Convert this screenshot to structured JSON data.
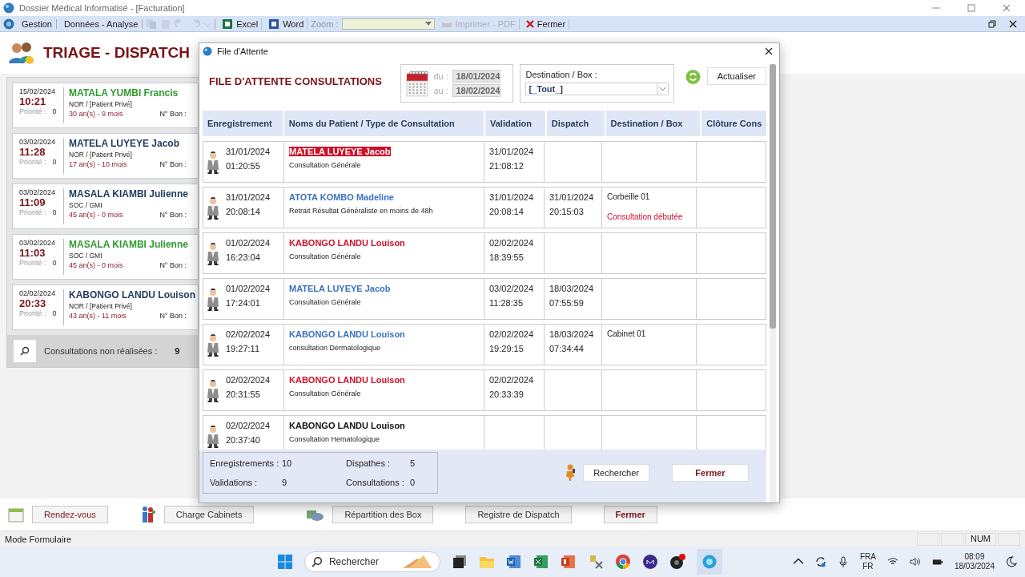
{
  "window": {
    "title": "Dossier Médical Informatisé - [Facturation]"
  },
  "toolbar": {
    "menus": [
      "Gestion",
      "Données - Analyse"
    ],
    "buttons": [
      {
        "label": "Excel",
        "kind": "excel"
      },
      {
        "label": "Word",
        "kind": "word"
      }
    ],
    "zoom_label": "Zoom :",
    "print": {
      "label": "Imprimer - PDF",
      "disabled": true
    },
    "close": "Fermer"
  },
  "page": {
    "title": "TRIAGE - DISPATCH"
  },
  "queue": [
    {
      "date": "15/02/2024",
      "time": "10:21",
      "priority_label": "Priorité :",
      "priority": "0",
      "name": "MATALA YUMBI Francis",
      "color": "#2e9b2e",
      "category": "NOR / [Patient Privé]",
      "age": "30 an(s) - 9 mois",
      "bon_label": "N° Bon :"
    },
    {
      "date": "03/02/2024",
      "time": "11:28",
      "priority_label": "Priorité :",
      "priority": "0",
      "name": "MATELA LUYEYE Jacob",
      "color": "#1f3a5c",
      "category": "NOR / [Patient Privé]",
      "age": "17 an(s) - 10 mois",
      "bon_label": "N° Bon :"
    },
    {
      "date": "03/02/2024",
      "time": "11:09",
      "priority_label": "Priorité :",
      "priority": "0",
      "name": "MASALA KIAMBI Julienne",
      "color": "#1f3a5c",
      "category": "SOC / GMI",
      "age": "45 an(s) - 0 mois",
      "bon_label": "N° Bon :"
    },
    {
      "date": "03/02/2024",
      "time": "11:03",
      "priority_label": "Priorité :",
      "priority": "0",
      "name": "MASALA KIAMBI Julienne",
      "color": "#2e9b2e",
      "category": "SOC / GMI",
      "age": "45 an(s) - 0 mois",
      "bon_label": "N° Bon :"
    },
    {
      "date": "02/02/2024",
      "time": "20:33",
      "priority_label": "Priorité :",
      "priority": "0",
      "name": "KABONGO LANDU Louison",
      "color": "#1f3a5c",
      "category": "NOR / [Patient Privé]",
      "age": "43 an(s) - 11 mois",
      "bon_label": "N° Bon :"
    }
  ],
  "queue_footer": {
    "label": "Consultations non réalisées :",
    "count": "9"
  },
  "bottom_buttons": [
    {
      "label": "Rendez-vous",
      "kind": "calendar"
    },
    {
      "label": "Charge Cabinets",
      "kind": "people"
    },
    {
      "label": "Répartition des Box",
      "kind": "box"
    },
    {
      "label": "Registre de Dispatch",
      "kind": "plain"
    },
    {
      "label": "Fermer",
      "kind": "close"
    }
  ],
  "dialog": {
    "title": "File d'Attente",
    "heading": "FILE D'ATTENTE CONSULTATIONS",
    "from_label": "du :",
    "from": "18/01/2024",
    "to_label": "au :",
    "to": "18/02/2024",
    "destination_label": "Destination / Box :",
    "destination": "[_Tout_]",
    "refresh": "Actualiser",
    "columns": [
      "Enregistrement",
      "Noms du Patient / Type de Consultation",
      "Validation",
      "Dispatch",
      "Destination / Box",
      "Clôture Cons"
    ],
    "rows": [
      {
        "reg_date": "31/01/2024",
        "reg_time": "01:20:55",
        "name": "MATELA LUYEYE Jacob",
        "color": "#d0102a",
        "selected": true,
        "type": "Consultation Générale",
        "validation_date": "31/01/2024",
        "validation_time": "21:08:12"
      },
      {
        "reg_date": "31/01/2024",
        "reg_time": "20:08:14",
        "name": "ATOTA KOMBO Madeline",
        "color": "#3b6fc4",
        "selected": false,
        "type": "Retrait Résultat Généraliste en moins de 48h",
        "validation_date": "31/01/2024",
        "validation_time": "20:08:14",
        "dispatch_date": "31/01/2024",
        "dispatch_time": "20:15:03",
        "destination": "Corbeille 01",
        "note": "Consultation débutée"
      },
      {
        "reg_date": "01/02/2024",
        "reg_time": "16:23:04",
        "name": "KABONGO LANDU Louison",
        "color": "#d0102a",
        "selected": false,
        "type": "Consultation Générale",
        "validation_date": "02/02/2024",
        "validation_time": "18:39:55"
      },
      {
        "reg_date": "01/02/2024",
        "reg_time": "17:24:01",
        "name": "MATELA LUYEYE Jacob",
        "color": "#3b6fc4",
        "selected": false,
        "type": "Consultation Générale",
        "validation_date": "03/02/2024",
        "validation_time": "11:28:35",
        "dispatch_date": "18/03/2024",
        "dispatch_time": "07:55:59"
      },
      {
        "reg_date": "02/02/2024",
        "reg_time": "19:27:11",
        "name": "KABONGO LANDU Louison",
        "color": "#3b6fc4",
        "selected": false,
        "type": "consultation Dermatologique",
        "validation_date": "02/02/2024",
        "validation_time": "19:29:15",
        "dispatch_date": "18/03/2024",
        "dispatch_time": "07:34:44",
        "destination": "Cabinet 01"
      },
      {
        "reg_date": "02/02/2024",
        "reg_time": "20:31:55",
        "name": "KABONGO LANDU Louison",
        "color": "#d0102a",
        "selected": false,
        "type": "Consultation Générale",
        "validation_date": "02/02/2024",
        "validation_time": "20:33:39"
      },
      {
        "reg_date": "02/02/2024",
        "reg_time": "20:37:40",
        "name": "KABONGO LANDU Louison",
        "color": "#111111",
        "selected": false,
        "type": "Consultation Hematologique"
      }
    ],
    "stats": [
      {
        "label": "Enregistrements :",
        "value": "10"
      },
      {
        "label": "Dispathes :",
        "value": "5"
      },
      {
        "label": "Validations :",
        "value": "9"
      },
      {
        "label": "Consultations :",
        "value": "0"
      }
    ],
    "search": "Rechercher",
    "close": "Fermer"
  },
  "status_bar": {
    "mode": "Mode Formulaire",
    "num": "NUM"
  },
  "taskbar": {
    "search": "Rechercher",
    "language": "FRA",
    "layout": "FR",
    "time": "08:09",
    "date": "18/03/2024"
  }
}
